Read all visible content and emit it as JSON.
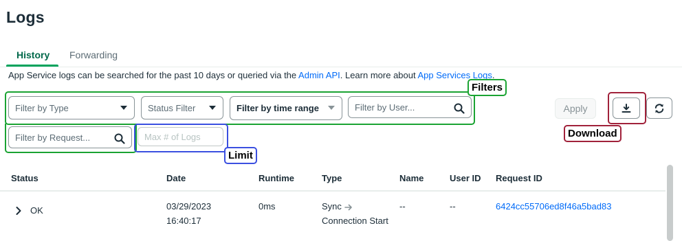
{
  "page": {
    "title": "Logs"
  },
  "tabs": [
    {
      "label": "History",
      "active": true
    },
    {
      "label": "Forwarding",
      "active": false
    }
  ],
  "info": {
    "text_before": "App Service logs can be searched for the past 10 days or queried via the ",
    "admin_api_link": "Admin API",
    "text_middle": ". Learn more about ",
    "docs_link": "App Services Logs",
    "text_after": "."
  },
  "filters": {
    "type_placeholder": "Filter by Type",
    "status_placeholder": "Status Filter",
    "time_range_label": "Filter by time range",
    "user_placeholder": "Filter by User...",
    "request_placeholder": "Filter by Request...",
    "limit_placeholder": "Max # of Logs"
  },
  "toolbar": {
    "apply_label": "Apply"
  },
  "annotations": {
    "filters": "Filters",
    "limit": "Limit",
    "download": "Download"
  },
  "table": {
    "headers": [
      "Status",
      "Date",
      "Runtime",
      "Type",
      "Name",
      "User ID",
      "Request ID"
    ],
    "rows": [
      {
        "status": "OK",
        "date": "03/29/2023",
        "time": "16:40:17",
        "runtime": "0ms",
        "type_line1": "Sync",
        "type_line2": "Connection Start",
        "name": "--",
        "user_id": "--",
        "request_id": "6424cc55706ed8f46a5bad83"
      }
    ]
  },
  "colors": {
    "accent_green": "#00684a",
    "link_blue": "#016bf8",
    "annotation_green": "#1aa332",
    "annotation_blue": "#3a4fe0",
    "annotation_red": "#a0213a"
  }
}
